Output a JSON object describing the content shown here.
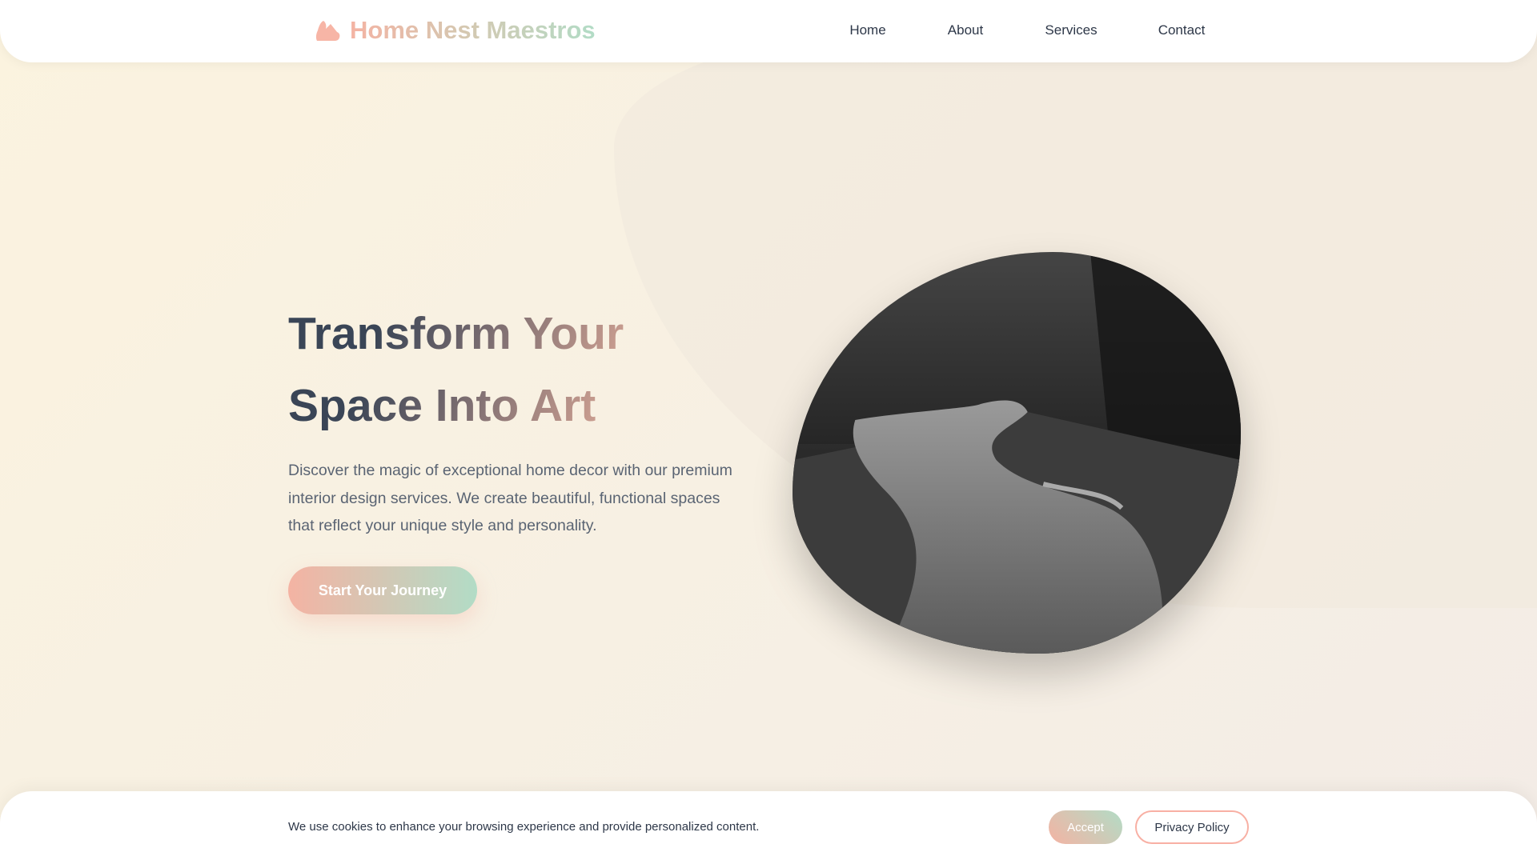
{
  "brand": {
    "name": "Home Nest Maestros",
    "icon": "house-leaf-icon"
  },
  "nav": {
    "items": [
      {
        "label": "Home"
      },
      {
        "label": "About"
      },
      {
        "label": "Services"
      },
      {
        "label": "Contact"
      }
    ]
  },
  "hero": {
    "title_line1": "Transform Your",
    "title_line2": "Space Into Art",
    "description": "Discover the magic of exceptional home decor with our premium interior design services. We create beautiful, functional spaces that reflect your unique style and personality.",
    "cta": "Start Your Journey"
  },
  "cookie": {
    "text": "We use cookies to enhance your browsing experience and provide personalized content.",
    "accept": "Accept",
    "privacy": "Privacy Policy"
  },
  "colors": {
    "accent_pink": "#f4b3a3",
    "accent_mint": "#b2dcc6",
    "text_dark": "#2d3748"
  }
}
